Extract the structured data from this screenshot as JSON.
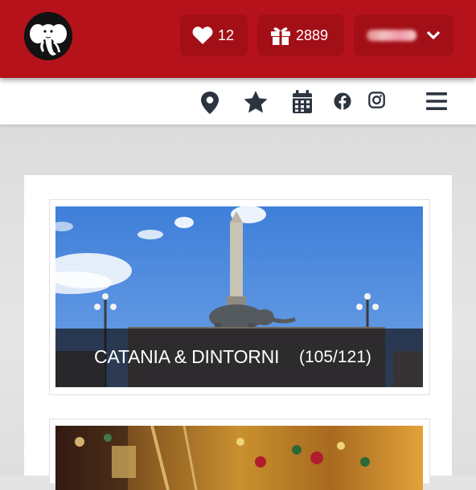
{
  "header": {
    "logo_icon": "elephant-logo-icon",
    "likes": {
      "icon": "heart-icon",
      "count": "12"
    },
    "gifts": {
      "icon": "gift-icon",
      "count": "2889"
    },
    "user": {
      "icon": "chevron-down-icon"
    }
  },
  "nav": {
    "icons": [
      "map-marker-icon",
      "star-icon",
      "calendar-icon",
      "facebook-icon",
      "instagram-icon",
      "menu-icon"
    ]
  },
  "cards": [
    {
      "title": "CATANIA & DINTORNI",
      "count": "(105/121)"
    },
    {
      "title": "",
      "count": ""
    }
  ],
  "colors": {
    "brand_red": "#b5121b",
    "pill_red": "#a30f17",
    "nav_icon": "#2d3440"
  }
}
